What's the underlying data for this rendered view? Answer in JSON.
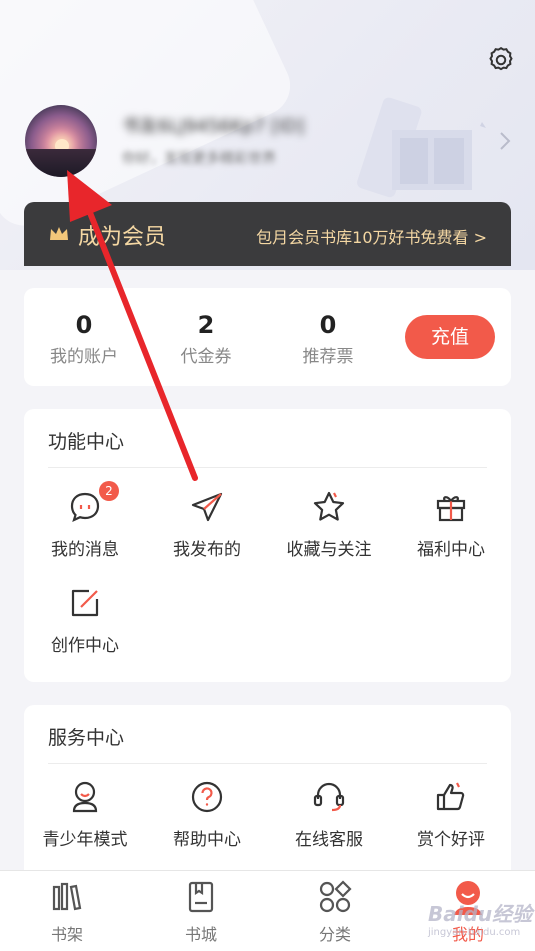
{
  "header": {
    "username": "书友6LJ9456Kp7 [ID]",
    "user_subtitle": "你好，发现更多精彩世界"
  },
  "vip": {
    "label": "成为会员",
    "promo": "包月会员书库10万好书免费看 >"
  },
  "stats": {
    "items": [
      {
        "value": "0",
        "label": "我的账户"
      },
      {
        "value": "2",
        "label": "代金券"
      },
      {
        "value": "0",
        "label": "推荐票"
      }
    ],
    "recharge_label": "充值"
  },
  "function_center": {
    "title": "功能中心",
    "items": [
      {
        "label": "我的消息",
        "icon": "message-icon",
        "badge": "2"
      },
      {
        "label": "我发布的",
        "icon": "paper-plane-icon"
      },
      {
        "label": "收藏与关注",
        "icon": "star-icon"
      },
      {
        "label": "福利中心",
        "icon": "gift-icon"
      },
      {
        "label": "创作中心",
        "icon": "edit-icon"
      }
    ]
  },
  "service_center": {
    "title": "服务中心",
    "items": [
      {
        "label": "青少年模式",
        "icon": "teen-mode-icon"
      },
      {
        "label": "帮助中心",
        "icon": "help-icon"
      },
      {
        "label": "在线客服",
        "icon": "headset-icon"
      },
      {
        "label": "赏个好评",
        "icon": "thumbs-up-icon"
      }
    ]
  },
  "bottom_nav": {
    "items": [
      {
        "label": "书架",
        "icon": "bookshelf-icon"
      },
      {
        "label": "书城",
        "icon": "bookstore-icon"
      },
      {
        "label": "分类",
        "icon": "category-icon"
      },
      {
        "label": "我的",
        "icon": "profile-icon",
        "active": true
      }
    ]
  },
  "watermark": {
    "text": "Baidu经验",
    "sub": "jingyan.baidu.com"
  },
  "colors": {
    "accent": "#f25a4a",
    "vip_bar": "#3b3b3d",
    "vip_text": "#f4d7a3"
  }
}
